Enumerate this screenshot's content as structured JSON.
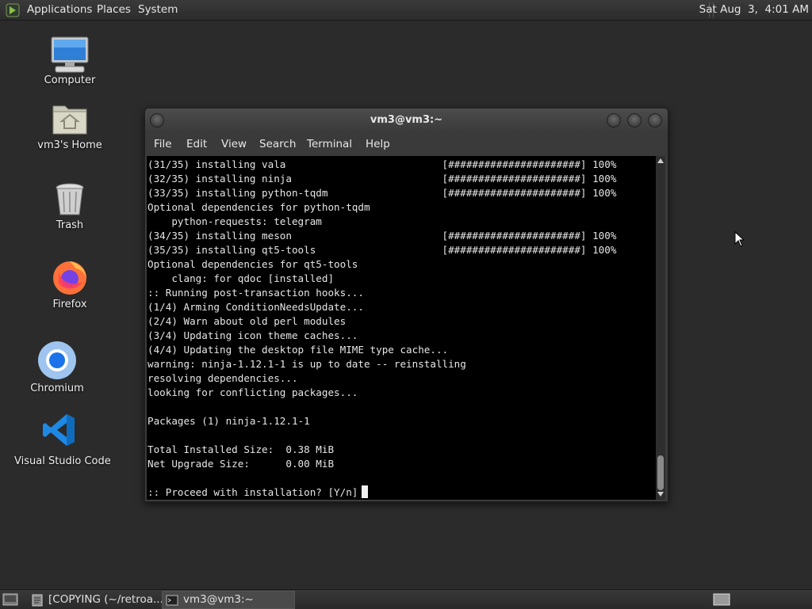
{
  "top_panel": {
    "menus": [
      "Applications",
      "Places",
      "System"
    ],
    "clock": "Sat Aug  3,  4:01 AM"
  },
  "desktop_icons": [
    {
      "label": "Computer",
      "icon": "computer-icon"
    },
    {
      "label": "vm3's Home",
      "icon": "home-folder-icon"
    },
    {
      "label": "Trash",
      "icon": "trash-icon"
    },
    {
      "label": "Firefox",
      "icon": "firefox-icon"
    },
    {
      "label": "Chromium",
      "icon": "chromium-icon"
    },
    {
      "label": "Visual Studio Code",
      "icon": "vscode-icon"
    }
  ],
  "terminal": {
    "title": "vm3@vm3:~",
    "menu": [
      "File",
      "Edit",
      "View",
      "Search",
      "Terminal",
      "Help"
    ],
    "lines": [
      "(31/35) installing vala                          [######################] 100%",
      "(32/35) installing ninja                         [######################] 100%",
      "(33/35) installing python-tqdm                   [######################] 100%",
      "Optional dependencies for python-tqdm",
      "    python-requests: telegram",
      "(34/35) installing meson                         [######################] 100%",
      "(35/35) installing qt5-tools                     [######################] 100%",
      "Optional dependencies for qt5-tools",
      "    clang: for qdoc [installed]",
      ":: Running post-transaction hooks...",
      "(1/4) Arming ConditionNeedsUpdate...",
      "(2/4) Warn about old perl modules",
      "(3/4) Updating icon theme caches...",
      "(4/4) Updating the desktop file MIME type cache...",
      "warning: ninja-1.12.1-1 is up to date -- reinstalling",
      "resolving dependencies...",
      "looking for conflicting packages...",
      "",
      "Packages (1) ninja-1.12.1-1",
      "",
      "Total Installed Size:  0.38 MiB",
      "Net Upgrade Size:      0.00 MiB",
      ""
    ],
    "prompt": ":: Proceed with installation? [Y/n]"
  },
  "taskbar": {
    "tasks": [
      {
        "label": "[COPYING (~/retroa...",
        "icon": "text-editor-icon",
        "active": false
      },
      {
        "label": "vm3@vm3:~",
        "icon": "terminal-icon",
        "active": true
      }
    ]
  }
}
